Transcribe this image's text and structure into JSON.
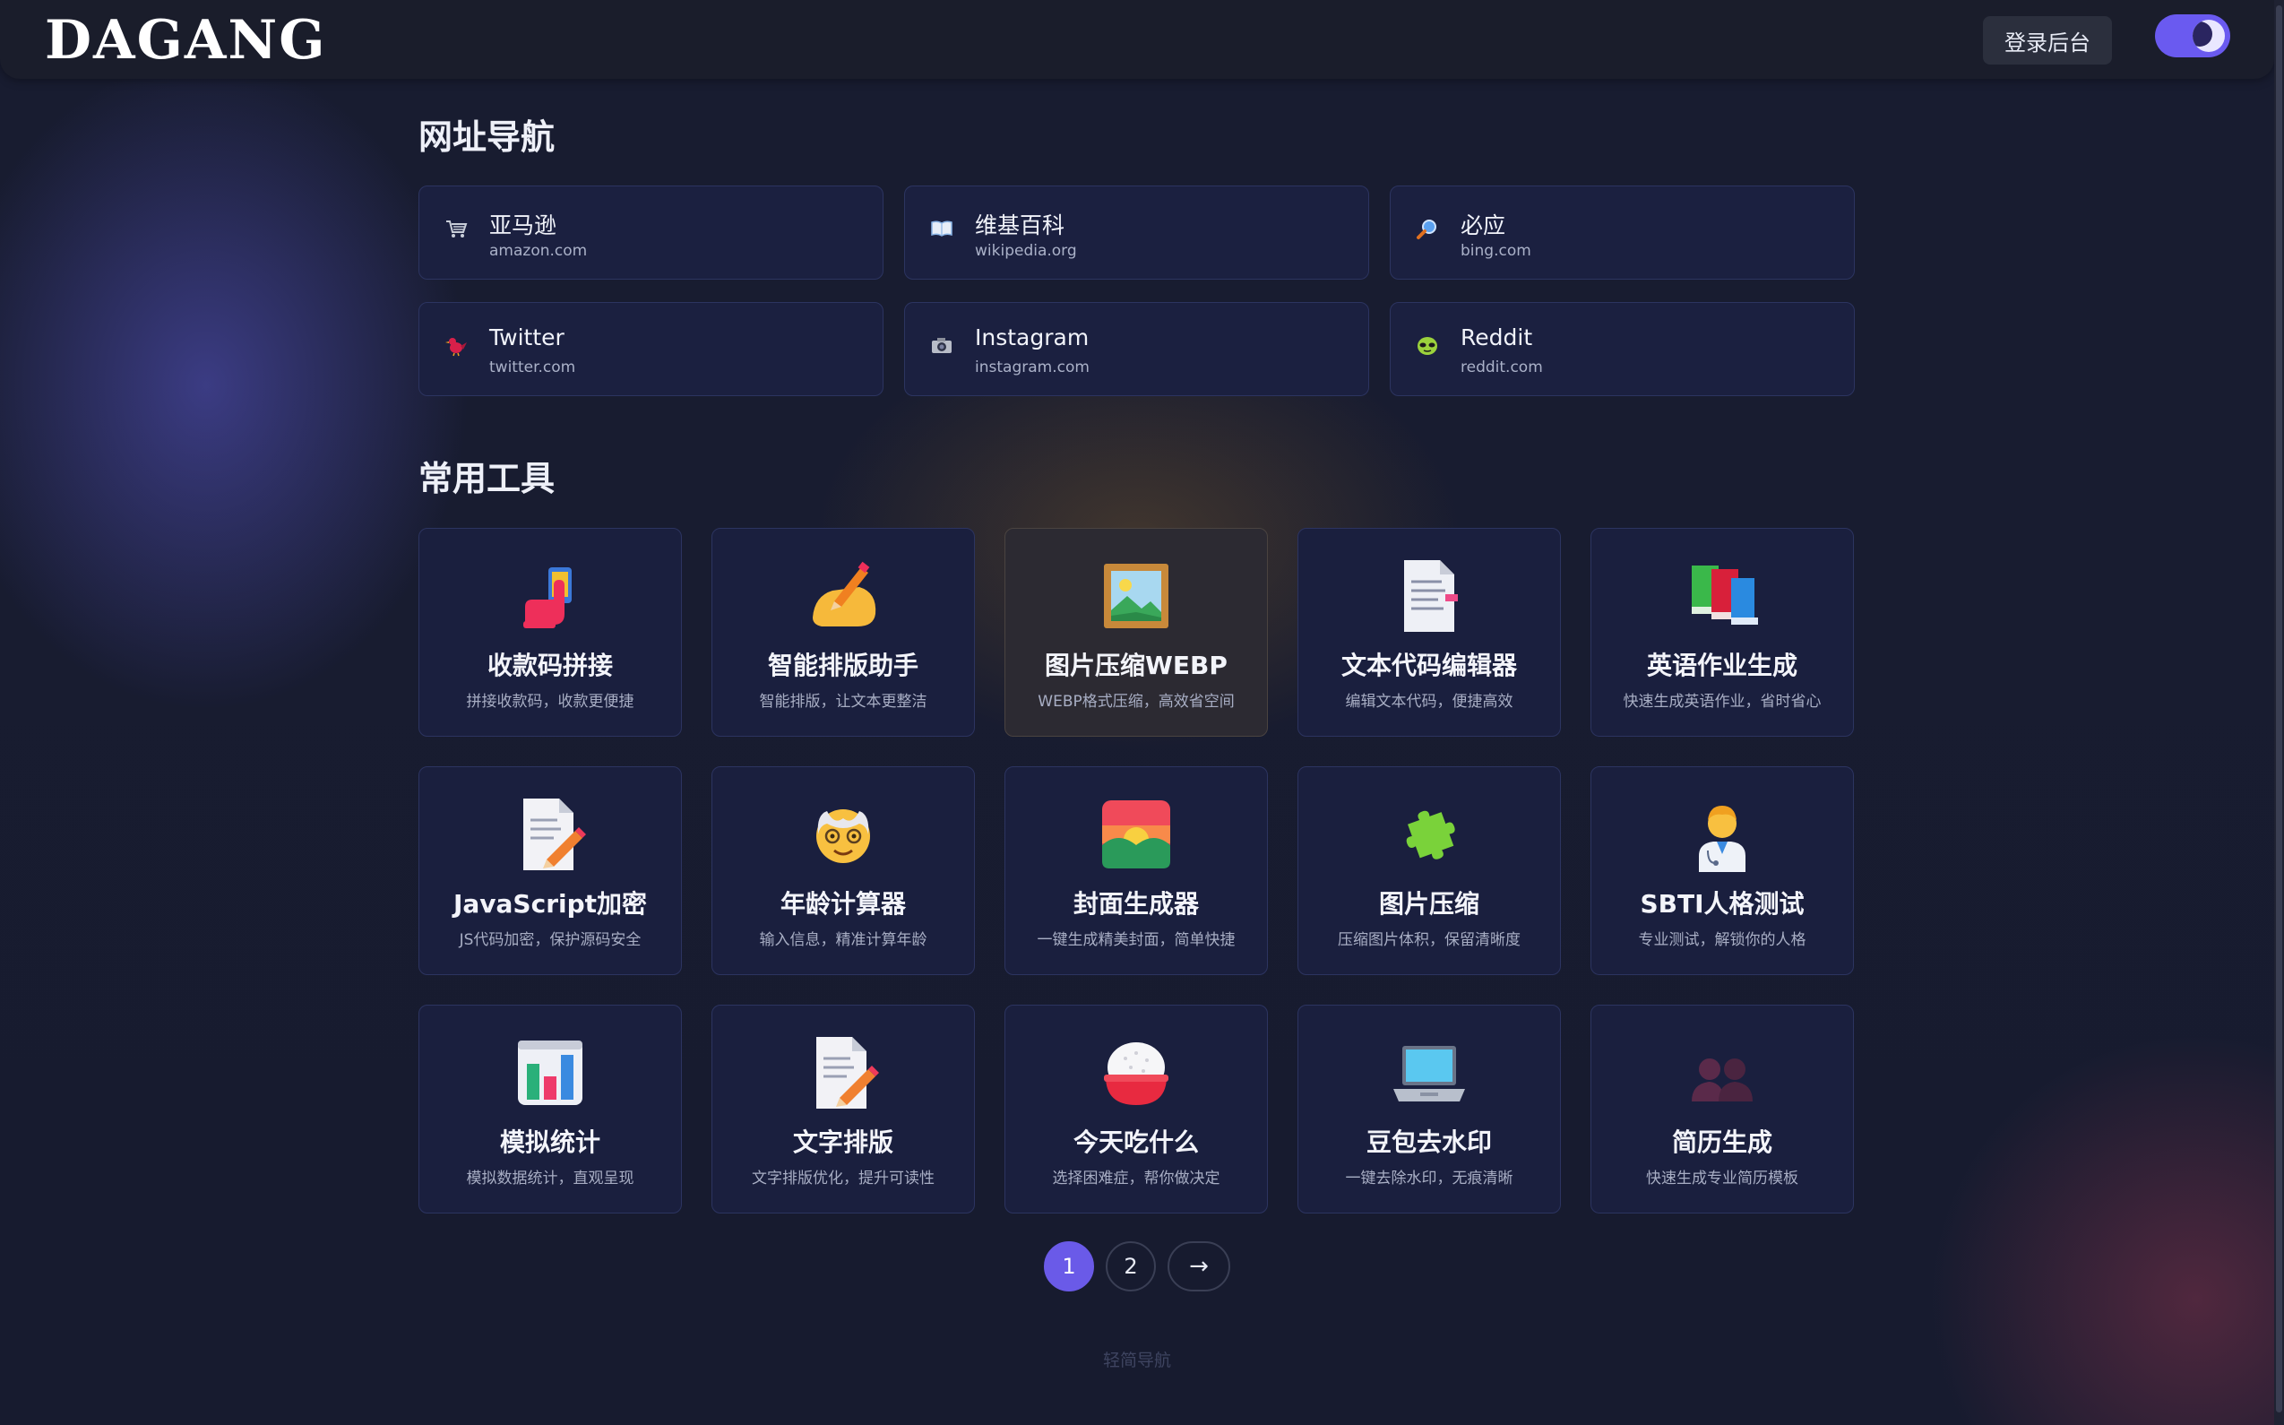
{
  "header": {
    "logo": "DAGANG",
    "login_label": "登录后台",
    "theme_toggle_state": "dark"
  },
  "nav_section": {
    "title": "网址导航",
    "items": [
      {
        "icon": "cart-icon",
        "name": "亚马逊",
        "url": "amazon.com"
      },
      {
        "icon": "book-icon",
        "name": "维基百科",
        "url": "wikipedia.org"
      },
      {
        "icon": "magnifier-icon",
        "name": "必应",
        "url": "bing.com"
      },
      {
        "icon": "bird-icon",
        "name": "Twitter",
        "url": "twitter.com"
      },
      {
        "icon": "camera-icon",
        "name": "Instagram",
        "url": "instagram.com"
      },
      {
        "icon": "alien-icon",
        "name": "Reddit",
        "url": "reddit.com"
      }
    ]
  },
  "tools_section": {
    "title": "常用工具",
    "items": [
      {
        "icon": "phone-hand-icon",
        "name": "收款码拼接",
        "desc": "拼接收款码，收款更便捷"
      },
      {
        "icon": "writing-hand-icon",
        "name": "智能排版助手",
        "desc": "智能排版，让文本更整洁"
      },
      {
        "icon": "framed-picture-icon",
        "name": "图片压缩WEBP",
        "desc": "WEBP格式压缩，高效省空间"
      },
      {
        "icon": "document-icon",
        "name": "文本代码编辑器",
        "desc": "编辑文本代码，便捷高效"
      },
      {
        "icon": "books-icon",
        "name": "英语作业生成",
        "desc": "快速生成英语作业，省时省心"
      },
      {
        "icon": "memo-icon",
        "name": "JavaScript加密",
        "desc": "JS代码加密，保护源码安全"
      },
      {
        "icon": "old-man-icon",
        "name": "年龄计算器",
        "desc": "输入信息，精准计算年龄"
      },
      {
        "icon": "sunrise-icon",
        "name": "封面生成器",
        "desc": "一键生成精美封面，简单快捷"
      },
      {
        "icon": "puzzle-icon",
        "name": "图片压缩",
        "desc": "压缩图片体积，保留清晰度"
      },
      {
        "icon": "doctor-icon",
        "name": "SBTI人格测试",
        "desc": "专业测试，解锁你的人格"
      },
      {
        "icon": "bar-chart-icon",
        "name": "模拟统计",
        "desc": "模拟数据统计，直观呈现"
      },
      {
        "icon": "memo-icon",
        "name": "文字排版",
        "desc": "文字排版优化，提升可读性"
      },
      {
        "icon": "rice-bowl-icon",
        "name": "今天吃什么",
        "desc": "选择困难症，帮你做决定"
      },
      {
        "icon": "laptop-icon",
        "name": "豆包去水印",
        "desc": "一键去除水印，无痕清晰"
      },
      {
        "icon": "people-icon",
        "name": "简历生成",
        "desc": "快速生成专业简历模板"
      }
    ]
  },
  "pagination": {
    "pages": [
      "1",
      "2"
    ],
    "current": "1",
    "next_label": "→"
  },
  "footer": {
    "text": "轻简导航"
  }
}
